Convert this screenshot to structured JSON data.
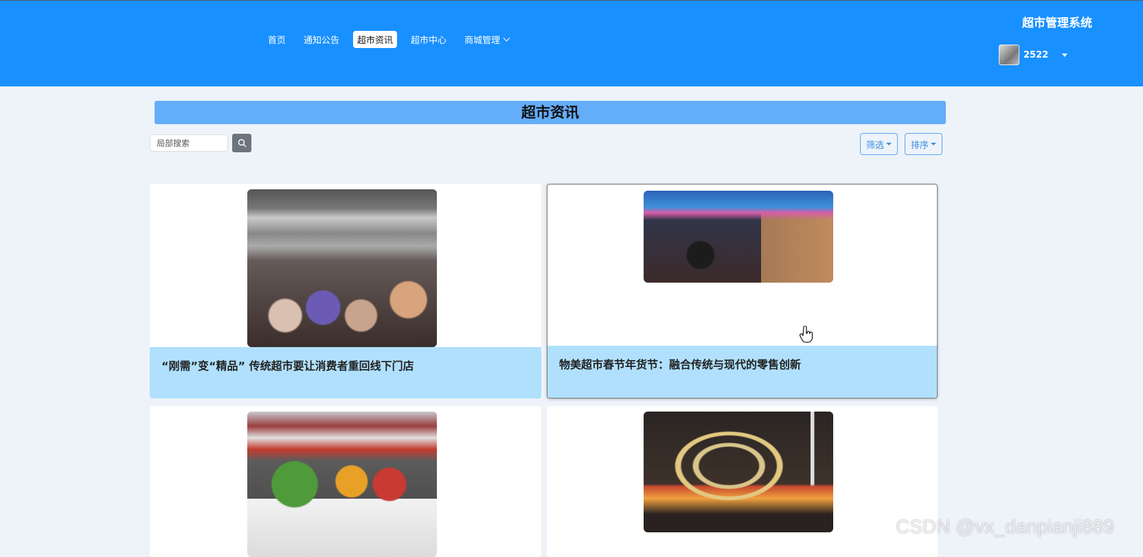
{
  "header": {
    "site_title": "超市管理系统",
    "nav": [
      {
        "label": "首页",
        "active": false
      },
      {
        "label": "通知公告",
        "active": false
      },
      {
        "label": "超市资讯",
        "active": true
      },
      {
        "label": "超市中心",
        "active": false
      },
      {
        "label": "商城管理",
        "active": false,
        "has_dropdown": true
      }
    ],
    "user": {
      "name": "2522",
      "avatar_icon": "user-avatar"
    },
    "bg_color": "#1990ff"
  },
  "page": {
    "title": "超市资讯",
    "search": {
      "placeholder": "局部搜索",
      "value": ""
    },
    "filter_label": "筛选",
    "sort_label": "排序"
  },
  "articles": [
    {
      "title": "“刚需”变“精品” 传统超市要让消费者重回线下门店",
      "image": "supermarket-crowd-photo"
    },
    {
      "title": "物美超市春节年货节：融合传统与现代的零售创新",
      "image": "supermarket-new-year-photo"
    },
    {
      "title": "",
      "image": "vegetable-shelf-photo"
    },
    {
      "title": "",
      "image": "supermarket-interior-photo"
    }
  ],
  "watermark": "CSDN @vx_danpianji889"
}
